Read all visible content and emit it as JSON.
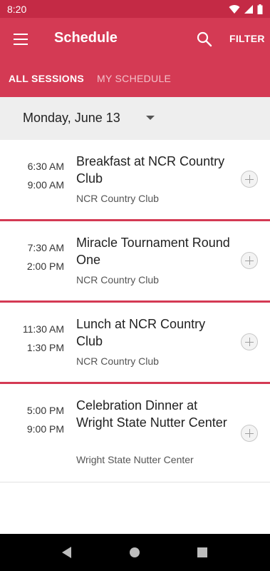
{
  "status": {
    "time": "8:20"
  },
  "app_bar": {
    "title": "Schedule",
    "filter_label": "FILTER"
  },
  "tabs": [
    {
      "label": "ALL SESSIONS",
      "active": true
    },
    {
      "label": "MY SCHEDULE",
      "active": false
    }
  ],
  "date_selector": {
    "value": "Monday, June 13"
  },
  "sessions": [
    {
      "start": "6:30 AM",
      "end": "9:00 AM",
      "title": "Breakfast at NCR Country Club",
      "location": "NCR Country Club"
    },
    {
      "start": "7:30 AM",
      "end": "2:00 PM",
      "title": "Miracle Tournament Round One",
      "location": "NCR Country Club"
    },
    {
      "start": "11:30 AM",
      "end": "1:30 PM",
      "title": "Lunch at NCR Country Club",
      "location": "NCR Country Club"
    },
    {
      "start": "5:00 PM",
      "end": "9:00 PM",
      "title": "Celebration Dinner at Wright State Nutter Center",
      "location": "Wright State Nutter Center"
    }
  ],
  "colors": {
    "primary": "#d43a54",
    "status_bar": "#c42a45",
    "date_bar": "#eeeeee"
  }
}
